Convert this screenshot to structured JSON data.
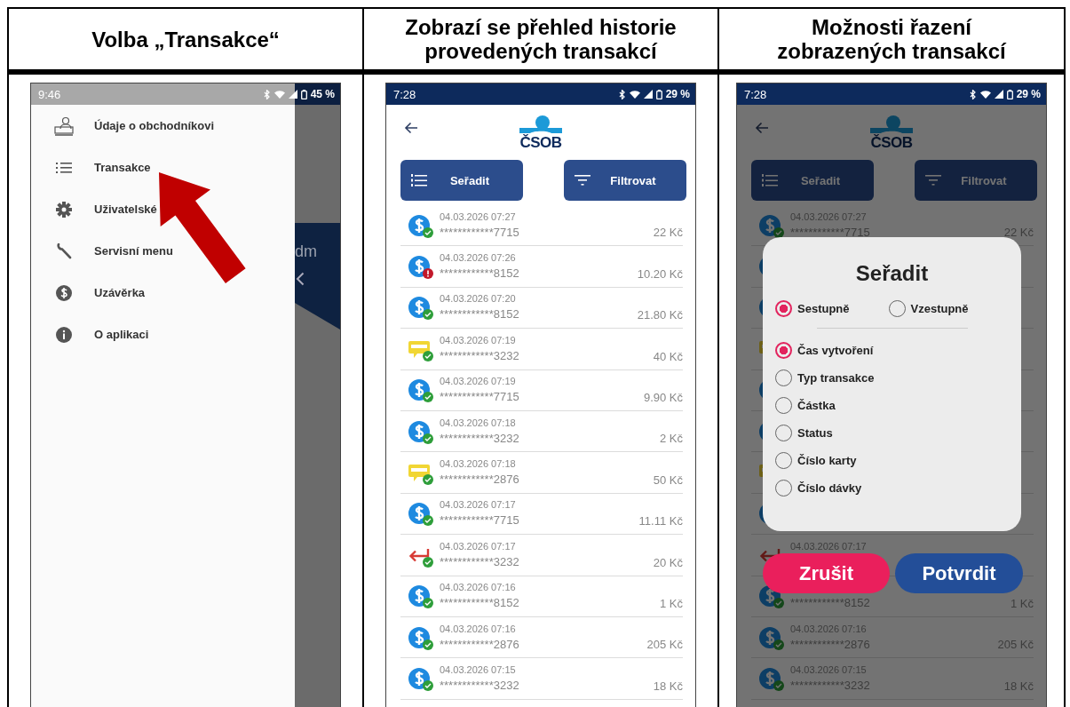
{
  "panels": [
    {
      "kind": "drawer",
      "heading": "Volba „Transakce“",
      "time": "9:46",
      "battery": "45 %",
      "menu": [
        {
          "label": "Údaje o obchodníkovi"
        },
        {
          "label": "Transakce"
        },
        {
          "label": "Uživatelské"
        },
        {
          "label": "Servisní menu"
        },
        {
          "label": "Uzávěrka"
        },
        {
          "label": "O aplikaci"
        }
      ],
      "behind_text": "dm"
    },
    {
      "kind": "list",
      "heading": "Zobrazí se přehled historie provedených transakcí",
      "time": "7:28",
      "battery": "29 %",
      "logo": "ČSOB",
      "sort_button": "Seřadit",
      "filter_button": "Filtrovat",
      "rows": [
        {
          "kind": "card",
          "failed": false,
          "date": "04.03.2026 07:27",
          "card": "************7715",
          "amount": "22 Kč"
        },
        {
          "kind": "card",
          "failed": true,
          "date": "04.03.2026 07:26",
          "card": "************8152",
          "amount": "10.20 Kč"
        },
        {
          "kind": "card",
          "failed": false,
          "date": "04.03.2026 07:20",
          "card": "************8152",
          "amount": "21.80 Kč"
        },
        {
          "kind": "voucher",
          "failed": false,
          "date": "04.03.2026 07:19",
          "card": "************3232",
          "amount": "40 Kč"
        },
        {
          "kind": "card",
          "failed": false,
          "date": "04.03.2026 07:19",
          "card": "************7715",
          "amount": "9.90 Kč"
        },
        {
          "kind": "card",
          "failed": false,
          "date": "04.03.2026 07:18",
          "card": "************3232",
          "amount": "2 Kč"
        },
        {
          "kind": "voucher",
          "failed": false,
          "date": "04.03.2026 07:18",
          "card": "************2876",
          "amount": "50 Kč"
        },
        {
          "kind": "card",
          "failed": false,
          "date": "04.03.2026 07:17",
          "card": "************7715",
          "amount": "11.11 Kč"
        },
        {
          "kind": "refund",
          "failed": false,
          "date": "04.03.2026 07:17",
          "card": "************3232",
          "amount": "20 Kč"
        },
        {
          "kind": "card",
          "failed": false,
          "date": "04.03.2026 07:16",
          "card": "************8152",
          "amount": "1 Kč"
        },
        {
          "kind": "card",
          "failed": false,
          "date": "04.03.2026 07:16",
          "card": "************2876",
          "amount": "205 Kč"
        },
        {
          "kind": "card",
          "failed": false,
          "date": "04.03.2026 07:15",
          "card": "************3232",
          "amount": "18 Kč"
        }
      ]
    },
    {
      "kind": "list",
      "heading": "Možnosti řazení zobrazených transakcí",
      "time": "7:28",
      "battery": "29 %",
      "logo": "ČSOB",
      "sort_button": "Seřadit",
      "filter_button": "Filtrovat",
      "rows": [
        {
          "kind": "card",
          "failed": false,
          "date": "04.03.2026 07:27",
          "card": "************7715",
          "amount": "22 Kč"
        },
        {
          "kind": "card"
        },
        {
          "kind": "card"
        },
        {
          "kind": "voucher"
        },
        {
          "kind": "card"
        },
        {
          "kind": "card"
        },
        {
          "kind": "voucher"
        },
        {
          "kind": "card"
        },
        {
          "kind": "refund",
          "date": "04.03.2026 07:17"
        },
        {
          "kind": "card",
          "failed": false,
          "card": "************8152",
          "amount": "1 Kč"
        },
        {
          "kind": "card",
          "failed": false,
          "date": "04.03.2026 07:16",
          "card": "************2876",
          "amount": "205 Kč"
        },
        {
          "kind": "card",
          "failed": false,
          "date": "04.03.2026 07:15",
          "card": "************3232",
          "amount": "18 Kč"
        }
      ],
      "dialog": {
        "title": "Seřadit",
        "order": [
          {
            "label": "Sestupně",
            "selected": true
          },
          {
            "label": "Vzestupně",
            "selected": false
          }
        ],
        "fields": [
          {
            "label": "Čas vytvoření",
            "selected": true
          },
          {
            "label": "Typ transakce",
            "selected": false
          },
          {
            "label": "Částka",
            "selected": false
          },
          {
            "label": "Status",
            "selected": false
          },
          {
            "label": "Číslo karty",
            "selected": false
          },
          {
            "label": "Číslo dávky",
            "selected": false
          }
        ],
        "cancel": "Zrušit",
        "confirm": "Potvrdit"
      }
    }
  ]
}
